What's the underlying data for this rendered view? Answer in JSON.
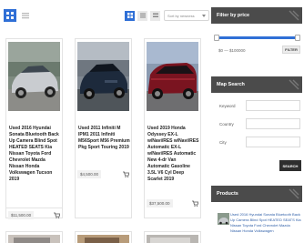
{
  "toolbar": {
    "sort_select_label": "Sort by newness"
  },
  "listings": [
    {
      "title": "Used 2016 Hyundai Sonata Bluetooth Back Up Camera Blind Spot HEATED SEATS Kia Nissan Toyota Ford Chevrolet Mazda Nissan Honda Volkswagen Tucson 2019",
      "price": "$11,500.00"
    },
    {
      "title": "Used 2011 Infiniti M IPM1 2011 Infiniti M56Sport M56 Premium Pkg Sport Touring 2019",
      "price": "$4,500.00"
    },
    {
      "title": "Used 2019 Honda Odyssey EX-L w/Navi/RES w/Navi/RES Automatic EX-L w/Navi/RES Automatic New 4-dr Van Automatic Gasoline 3.5L V6 Cyl Deep Scarlet 2019",
      "price": "$37,500.00"
    }
  ],
  "sidebar": {
    "price_filter": {
      "heading": "Filter by price",
      "range_label": "$0 — $100000",
      "filter_button": "FILTER",
      "range_min_fraction": 0.0,
      "range_max_fraction": 1.0
    },
    "map_search": {
      "heading": "Map Search",
      "keyword_label": "Keyword",
      "country_label": "Country",
      "city_label": "City",
      "search_button": "SEARCH"
    },
    "products": {
      "heading": "Products",
      "item_text": "Used 2016 Hyundai Sonata Bluetooth Back Up Camera Blind Spot HEATED SEATS Kia Nissan Toyota Ford Chevrolet Mazda Nissan Honda Volkswagen"
    }
  },
  "colors": {
    "accent": "#2f6fd6",
    "widget_header": "#4b4b4b",
    "search_button": "#2e2e2e"
  }
}
